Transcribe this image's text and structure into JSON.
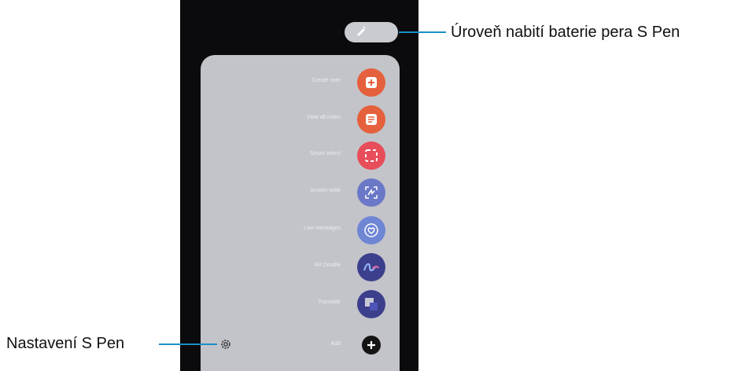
{
  "annotations": {
    "battery": "Úroveň nabití baterie pera S Pen",
    "settings": "Nastavení S Pen"
  },
  "pen_status": {
    "battery_text": "·····"
  },
  "menu": [
    {
      "label": "Create note",
      "icon": "create-note-icon",
      "color": "#e5603c"
    },
    {
      "label": "View all notes",
      "icon": "view-all-notes-icon",
      "color": "#e5603c"
    },
    {
      "label": "Smart select",
      "icon": "smart-select-icon",
      "color": "#e84d5a"
    },
    {
      "label": "Screen write",
      "icon": "screen-write-icon",
      "color": "#6b78c7"
    },
    {
      "label": "Live messages",
      "icon": "live-messages-icon",
      "color": "#6f86d4"
    },
    {
      "label": "AR Doodle",
      "icon": "ar-doodle-icon",
      "color": "#3c3f8c"
    },
    {
      "label": "Translate",
      "icon": "translate-icon",
      "color": "#3c3f8c"
    }
  ],
  "add": {
    "label": "Add",
    "icon": "add-icon",
    "color": "#141414"
  },
  "colors": {
    "accent_line": "#1a8fc7",
    "panel": "#c3c4c9",
    "phone_bg": "#0b0b0d"
  }
}
